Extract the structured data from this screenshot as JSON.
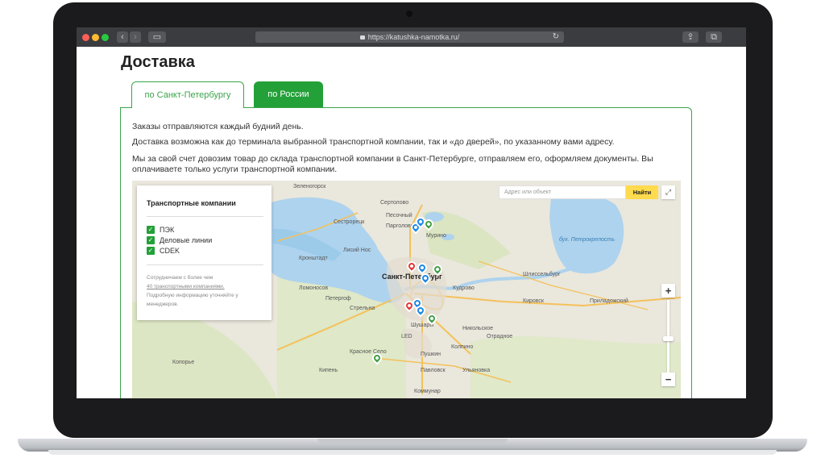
{
  "browser": {
    "url": "https://katushka-namotka.ru/",
    "traffic_lights": [
      "#ff5f57",
      "#febc2e",
      "#28c840"
    ]
  },
  "page": {
    "title": "Доставка"
  },
  "tabs": [
    {
      "label": "по Санкт-Петербургу",
      "active": true
    },
    {
      "label": "по России",
      "active": false
    }
  ],
  "content": {
    "paragraphs": [
      "Заказы отправляются каждый будний день.",
      "Доставка возможна как до терминала выбранной транспортной компании, так и «до дверей», по указанному вами адресу.",
      "Мы за свой счет довозим товар до склада транспортной компании в Санкт-Петербурге, отправляем его, оформляем документы. Вы оплачиваете только услуги транспортной компании."
    ]
  },
  "map": {
    "legend": {
      "title": "Транспортные компании",
      "companies": [
        {
          "name": "ПЭК",
          "checked": true
        },
        {
          "name": "Деловые линии",
          "checked": true
        },
        {
          "name": "CDEK",
          "checked": true
        }
      ],
      "note_prefix": "Сотрудничаем с более чем",
      "note_link": "40 транспортными компаниями.",
      "note_suffix": "Подробную информацию уточняйте у менеджеров."
    },
    "search": {
      "placeholder": "Адрес или объект",
      "button": "Найти"
    },
    "zoom": {
      "in": "+",
      "out": "−"
    },
    "labels": {
      "zelenogorsk": "Зеленогорск",
      "sertolovo": "Сертолово",
      "sestroretsk": "Сестрорецк",
      "pesochny": "Песочный",
      "pargolovo": "Парголово",
      "murino": "Мурино",
      "lisiy_nos": "Лисий Нос",
      "kronshtadt": "Кронштадт",
      "spb": "Санкт-Петербург",
      "kudrovo": "Кудрово",
      "lomonosov": "Ломоносов",
      "petergof": "Петергоф",
      "strelna": "Стрельна",
      "shushary": "Шушары",
      "kolpino": "Колпино",
      "pushkin": "Пушкин",
      "krasnoe_selo": "Красное Село",
      "pavlovsk": "Павловск",
      "kommunar": "Коммунар",
      "kopore": "Копорье",
      "kipen": "Кипень",
      "shlisselburg": "Шлиссельбург",
      "kirovsk": "Кировск",
      "otradnoe": "Отрадное",
      "nikolskoe": "Никольское",
      "ulyanovka": "Ульяновка",
      "pridorozhny": "Приладожский",
      "petrokrepost": "бух. Петрокрепость",
      "led": "LED"
    },
    "pin_colors": {
      "red": "#e53935",
      "blue": "#1e88e5",
      "green": "#43a047"
    }
  }
}
